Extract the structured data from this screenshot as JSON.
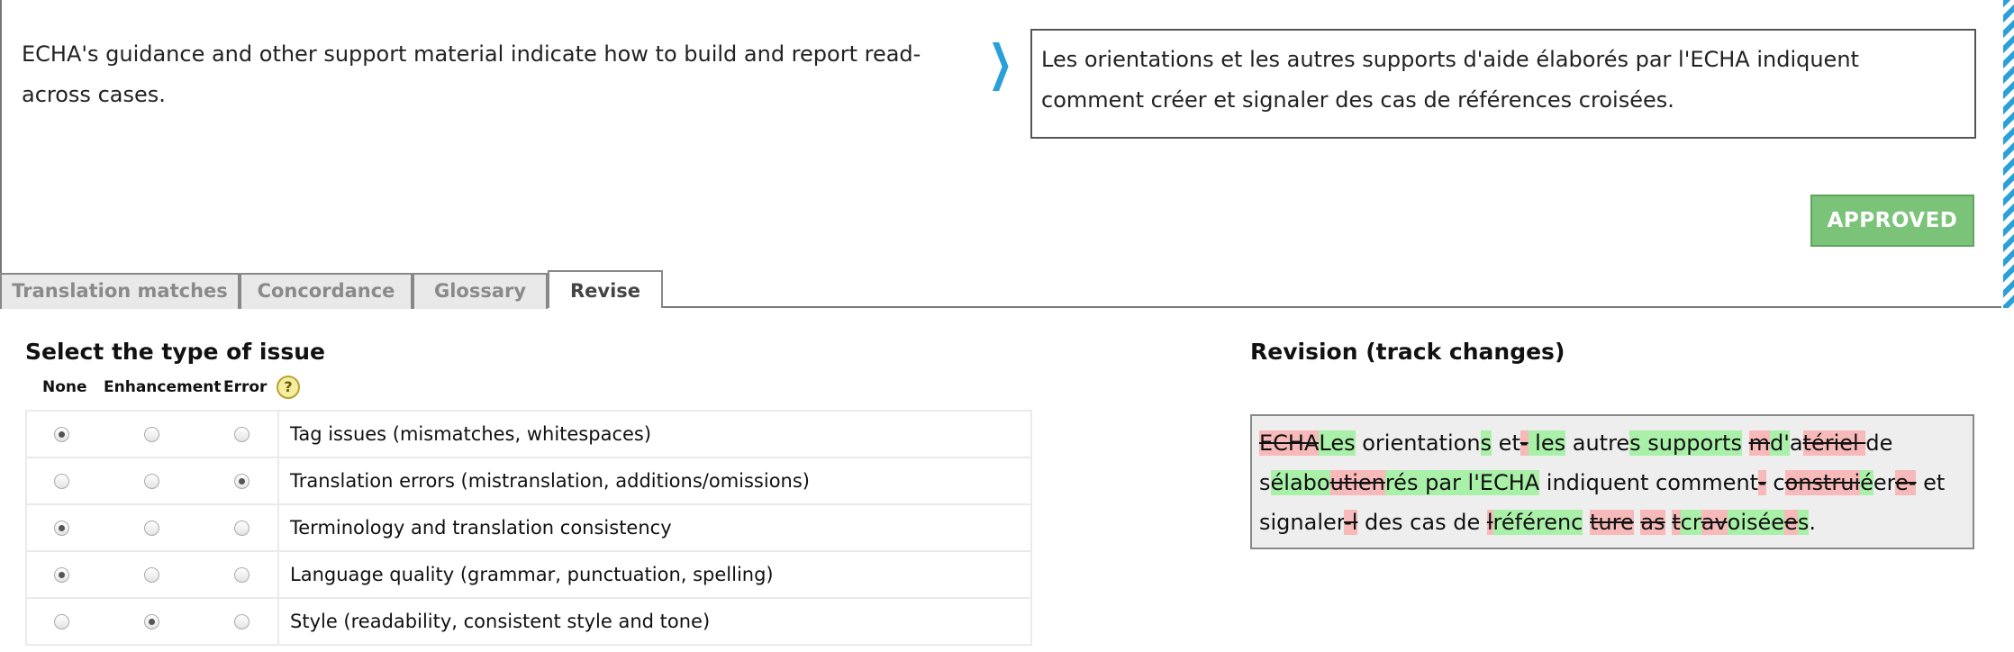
{
  "segment": {
    "source": "ECHA's guidance and other support material indicate how to build and report read-across cases.",
    "target": "Les orientations et les autres supports d'aide élaborés par l'ECHA indiquent comment créer et signaler des cas de références croisées.",
    "status_label": "APPROVED",
    "nav_icon": "chevron-right-icon"
  },
  "tabs": [
    {
      "label": "Translation matches",
      "active": false
    },
    {
      "label": "Concordance",
      "active": false
    },
    {
      "label": "Glossary",
      "active": false
    },
    {
      "label": "Revise",
      "active": true
    }
  ],
  "issues": {
    "heading": "Select the type of issue",
    "columns": [
      "None",
      "Enhancement",
      "Error"
    ],
    "help_icon": "?",
    "rows": [
      {
        "label": "Tag issues (mismatches, whitespaces)",
        "selected": "None"
      },
      {
        "label": "Translation errors (mistranslation, additions/omissions)",
        "selected": "Error"
      },
      {
        "label": "Terminology and translation consistency",
        "selected": "None"
      },
      {
        "label": "Language quality (grammar, punctuation, spelling)",
        "selected": "None"
      },
      {
        "label": "Style (readability, consistent style and tone)",
        "selected": "Enhancement"
      }
    ]
  },
  "revision": {
    "heading": "Revision (track changes)",
    "segments": [
      {
        "t": "ECHA",
        "type": "del"
      },
      {
        "t": "Les",
        "type": "ins"
      },
      {
        "t": " orientation",
        "type": "same"
      },
      {
        "t": "s",
        "type": "ins"
      },
      {
        "t": " et",
        "type": "same"
      },
      {
        "t": "-",
        "type": "del"
      },
      {
        "t": " les",
        "type": "ins"
      },
      {
        "t": " autre",
        "type": "same"
      },
      {
        "t": "s supports",
        "type": "ins"
      },
      {
        "t": " ",
        "type": "same"
      },
      {
        "t": "m",
        "type": "del"
      },
      {
        "t": "d'",
        "type": "ins"
      },
      {
        "t": "a",
        "type": "same"
      },
      {
        "t": "tériel ",
        "type": "del"
      },
      {
        "t": "de",
        "type": "same"
      },
      {
        "t": " s",
        "type": "same"
      },
      {
        "t": "élabo",
        "type": "ins"
      },
      {
        "t": "utien",
        "type": "del"
      },
      {
        "t": "rés par l'ECHA",
        "type": "ins"
      },
      {
        "t": " indiquent comment",
        "type": "same"
      },
      {
        "t": "-",
        "type": "del"
      },
      {
        "t": " c",
        "type": "same"
      },
      {
        "t": "onstrui",
        "type": "del"
      },
      {
        "t": "é",
        "type": "ins"
      },
      {
        "t": "er",
        "type": "same"
      },
      {
        "t": "e-",
        "type": "del"
      },
      {
        "t": " et",
        "type": "same"
      },
      {
        "t": " signaler",
        "type": "same"
      },
      {
        "t": "-l",
        "type": "del"
      },
      {
        "t": " des cas de ",
        "type": "same"
      },
      {
        "t": "l",
        "type": "del"
      },
      {
        "t": "référenc",
        "type": "ins"
      },
      {
        "t": " ",
        "type": "same"
      },
      {
        "t": "ture",
        "type": "del"
      },
      {
        "t": " ",
        "type": "same"
      },
      {
        "t": "as",
        "type": "del"
      },
      {
        "t": " ",
        "type": "same"
      },
      {
        "t": "t",
        "type": "del"
      },
      {
        "t": "cr",
        "type": "ins"
      },
      {
        "t": "av",
        "type": "del"
      },
      {
        "t": "oisée",
        "type": "ins"
      },
      {
        "t": "e",
        "type": "del"
      },
      {
        "t": "s",
        "type": "ins"
      },
      {
        "t": ".",
        "type": "same"
      }
    ]
  },
  "colors": {
    "accent": "#2aa0d8",
    "approved": "#7cc37a",
    "insert_highlight": "#a9f0a9",
    "delete_highlight": "#f7b9b9"
  }
}
